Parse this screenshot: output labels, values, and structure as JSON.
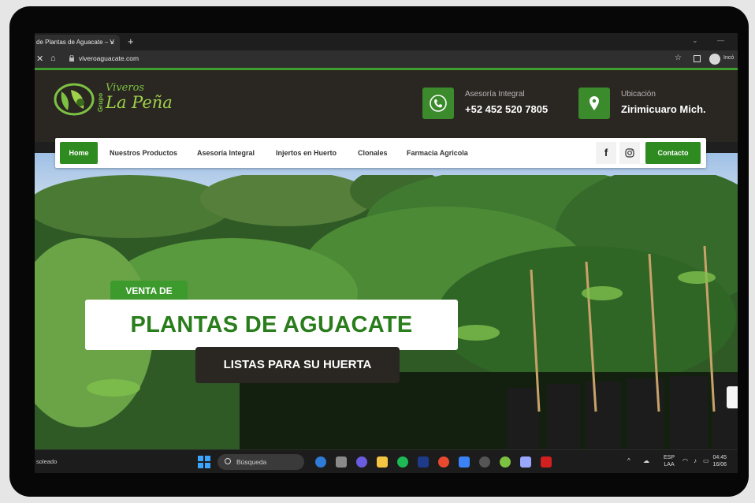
{
  "browser": {
    "tab_title": "de Plantas de Aguacate – V",
    "tab_close": "×",
    "new_tab": "+",
    "url": "viveroaguacate.com",
    "profile_label": "Incó"
  },
  "header": {
    "logo": {
      "grupo": "Grupo",
      "viveros": "Viveros",
      "name": "La Peña"
    },
    "advisory": {
      "label": "Asesoría Integral",
      "value": "+52 452 520 7805"
    },
    "location": {
      "label": "Ubicación",
      "value": "Zirimicuaro Mich."
    }
  },
  "nav": {
    "home": "Home",
    "items": [
      "Nuestros Productos",
      "Asesoría Integral",
      "Injertos en Huerto",
      "Clonales",
      "Farmacia Agricola"
    ],
    "facebook": "f",
    "contact": "Contacto"
  },
  "hero": {
    "badge": "VENTA DE",
    "title": "PLANTAS DE AGUACATE",
    "subtitle": "LISTAS PARA SU HUERTA"
  },
  "taskbar": {
    "weather": "soleado",
    "search_placeholder": "Búsqueda",
    "lang_top": "ESP",
    "lang_bottom": "LAA",
    "time": "04:45",
    "date": "16/06"
  },
  "colors": {
    "brand_green": "#2e8b1f",
    "header_dark": "#2a2622",
    "accent_line": "#3fa030"
  }
}
